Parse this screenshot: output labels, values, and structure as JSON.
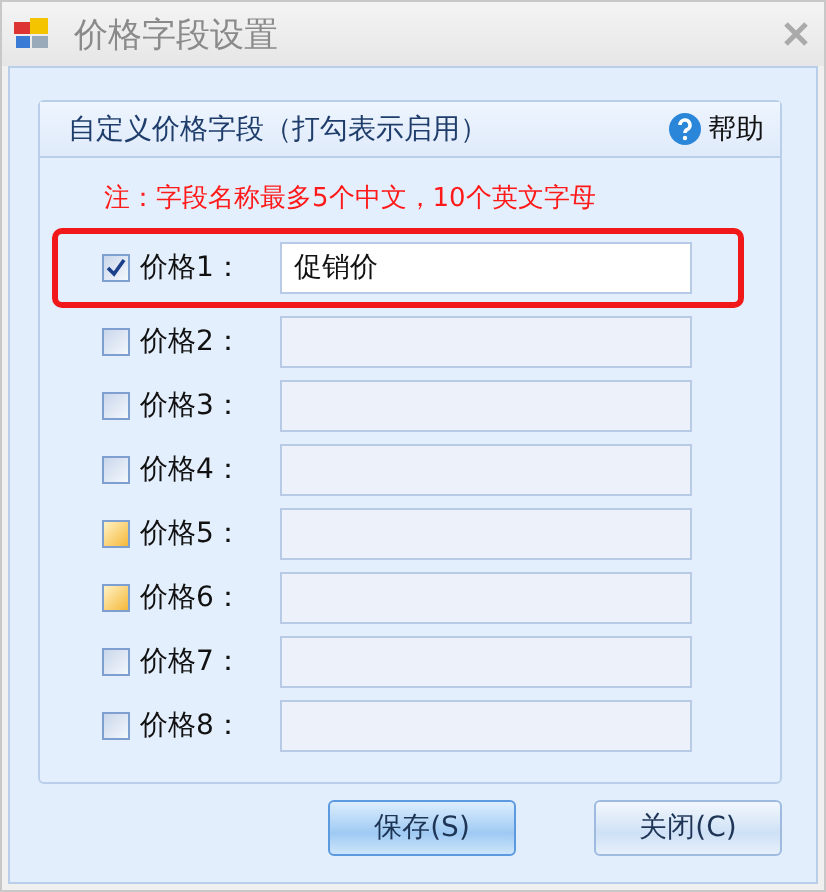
{
  "window": {
    "title": "价格字段设置"
  },
  "group": {
    "title": "自定义价格字段（打勾表示启用）",
    "help": "帮助"
  },
  "note": "注：字段名称最多5个中文，10个英文字母",
  "fields": [
    {
      "label": "价格1：",
      "checked": true,
      "hovered": false,
      "highlighted": true,
      "value": "促销价"
    },
    {
      "label": "价格2：",
      "checked": false,
      "hovered": false,
      "highlighted": false
    },
    {
      "label": "价格3：",
      "checked": false,
      "hovered": false,
      "highlighted": false
    },
    {
      "label": "价格4：",
      "checked": false,
      "hovered": false,
      "highlighted": false
    },
    {
      "label": "价格5：",
      "checked": false,
      "hovered": true,
      "highlighted": false
    },
    {
      "label": "价格6：",
      "checked": false,
      "hovered": true,
      "highlighted": false
    },
    {
      "label": "价格7：",
      "checked": false,
      "hovered": false,
      "highlighted": false
    },
    {
      "label": "价格8：",
      "checked": false,
      "hovered": false,
      "highlighted": false
    }
  ],
  "buttons": [
    {
      "label": "保存(S)",
      "default": true
    },
    {
      "label": "关闭(C)",
      "default": false
    }
  ]
}
